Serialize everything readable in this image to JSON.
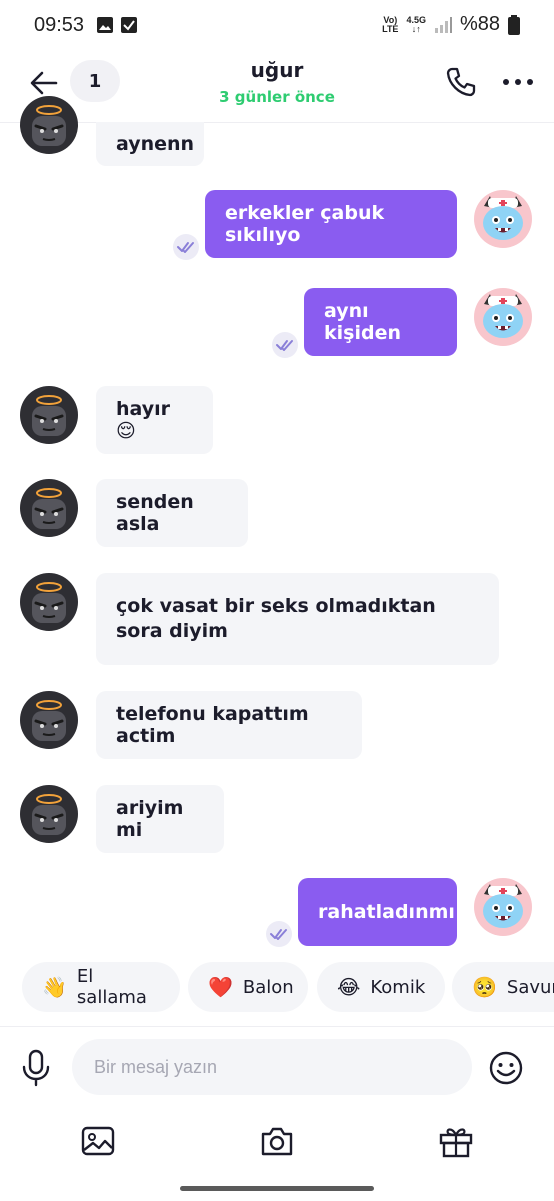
{
  "status_bar": {
    "time": "09:53",
    "network_top": "Vo)",
    "network_bottom": "LTE",
    "data_top": "4.5G",
    "data_bottom": "↓↑",
    "battery": "%88"
  },
  "header": {
    "badge_count": "1",
    "contact_name": "uğur",
    "last_seen": "3 günler önce"
  },
  "messages": [
    {
      "side": "in",
      "text": "aynenn"
    },
    {
      "side": "out",
      "text": "erkekler çabuk sıkılıyo"
    },
    {
      "side": "out",
      "text": "aynı kişiden"
    },
    {
      "side": "in",
      "text": "hayır 😌"
    },
    {
      "side": "in",
      "text": "senden asla"
    },
    {
      "side": "in",
      "text": "çok vasat bir seks olmadıktan sora diyim"
    },
    {
      "side": "in",
      "text": "telefonu kapattım actim"
    },
    {
      "side": "in",
      "text": "ariyim mi"
    },
    {
      "side": "out",
      "text": "rahatladınmı"
    }
  ],
  "quick_reactions": [
    {
      "emoji": "👋",
      "label": "El sallama"
    },
    {
      "emoji": "❤️",
      "label": "Balon"
    },
    {
      "emoji": "😂",
      "label": "Komik"
    },
    {
      "emoji": "🥺",
      "label": "Savunmasız"
    }
  ],
  "input": {
    "placeholder": "Bir mesaj yazın"
  },
  "colors": {
    "accent": "#8a5cf0",
    "online_green": "#2ecc71",
    "incoming_bubble": "#f4f5f8"
  },
  "icons": {
    "back": "arrow-left-icon",
    "call": "phone-icon",
    "more": "more-horizontal-icon",
    "mic": "microphone-icon",
    "emoji": "smiley-icon",
    "gallery": "image-icon",
    "camera": "camera-icon",
    "gift": "gift-icon",
    "read": "double-check-icon"
  }
}
